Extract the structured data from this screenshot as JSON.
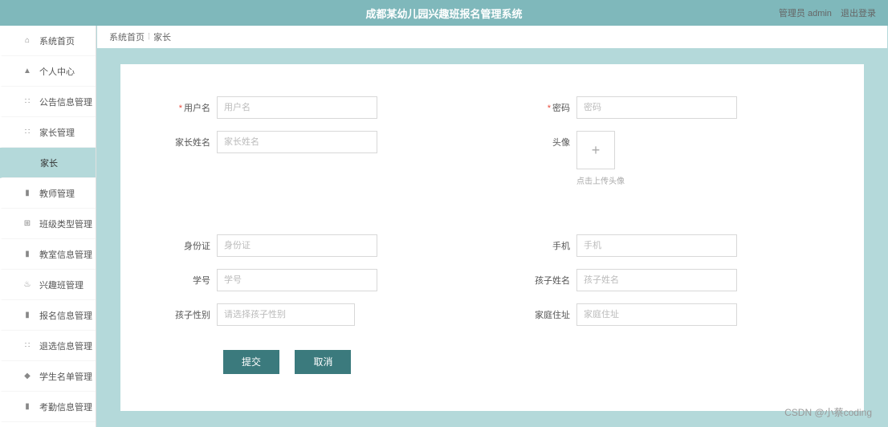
{
  "header": {
    "title": "成都某幼儿园兴趣班报名管理系统",
    "admin_label": "管理员 admin",
    "logout_label": "退出登录"
  },
  "sidebar": {
    "items": [
      {
        "icon": "home",
        "label": "系统首页"
      },
      {
        "icon": "user",
        "label": "个人中心"
      },
      {
        "icon": "grid",
        "label": "公告信息管理"
      },
      {
        "icon": "grid",
        "label": "家长管理"
      },
      {
        "icon": "",
        "label": "家长",
        "active": true
      },
      {
        "icon": "book",
        "label": "教师管理"
      },
      {
        "icon": "grid2",
        "label": "班级类型管理"
      },
      {
        "icon": "book",
        "label": "教室信息管理"
      },
      {
        "icon": "gift",
        "label": "兴趣班管理"
      },
      {
        "icon": "book",
        "label": "报名信息管理"
      },
      {
        "icon": "grid",
        "label": "退选信息管理"
      },
      {
        "icon": "dot",
        "label": "学生名单管理"
      },
      {
        "icon": "book",
        "label": "考勤信息管理"
      }
    ]
  },
  "breadcrumb": {
    "home": "系统首页",
    "current": "家长"
  },
  "form": {
    "username_label": "用户名",
    "username_ph": "用户名",
    "password_label": "密码",
    "password_ph": "密码",
    "parent_name_label": "家长姓名",
    "parent_name_ph": "家长姓名",
    "avatar_label": "头像",
    "avatar_hint": "点击上传头像",
    "idcard_label": "身份证",
    "idcard_ph": "身份证",
    "phone_label": "手机",
    "phone_ph": "手机",
    "student_no_label": "学号",
    "student_no_ph": "学号",
    "child_name_label": "孩子姓名",
    "child_name_ph": "孩子姓名",
    "child_gender_label": "孩子性别",
    "child_gender_ph": "请选择孩子性别",
    "address_label": "家庭住址",
    "address_ph": "家庭住址",
    "submit": "提交",
    "cancel": "取消"
  },
  "watermark": "CSDN @小蔡coding",
  "icons": {
    "home": "⌂",
    "user": "▲",
    "grid": "∷",
    "book": "▮",
    "grid2": "⊞",
    "gift": "♨",
    "dot": "◆",
    "plus": "+"
  }
}
